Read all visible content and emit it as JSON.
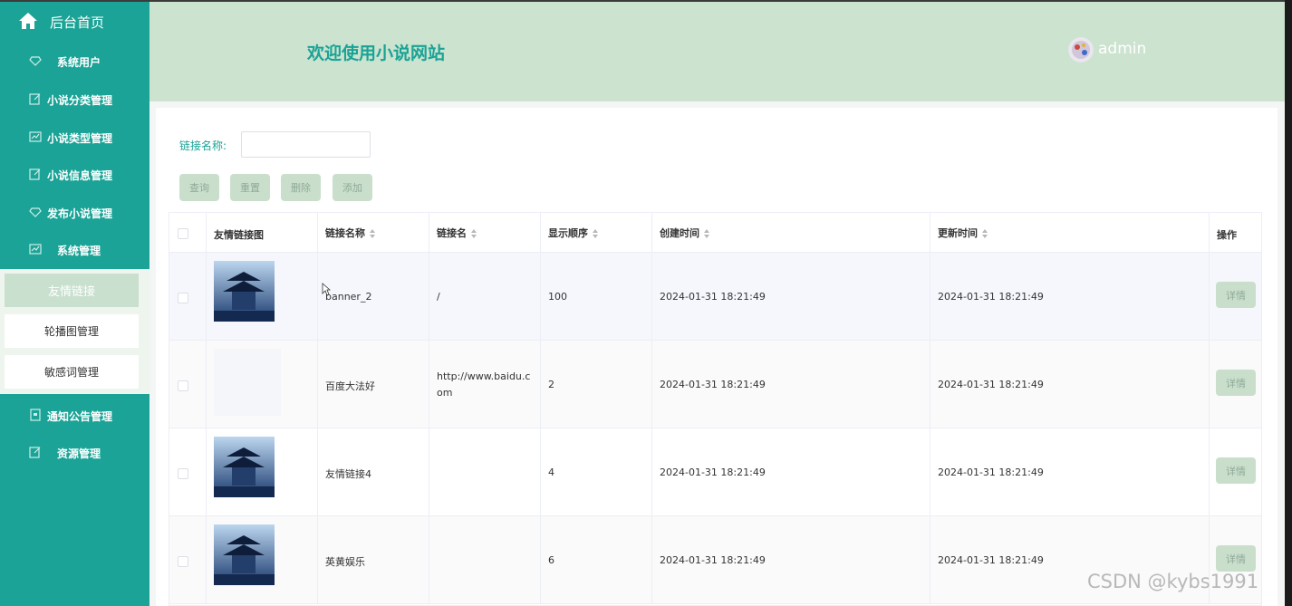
{
  "sidebar": {
    "home_label": "后台首页",
    "items": [
      {
        "label": "系统用户",
        "icon": "diamond-icon"
      },
      {
        "label": "小说分类管理",
        "icon": "edit-icon"
      },
      {
        "label": "小说类型管理",
        "icon": "chart-icon"
      },
      {
        "label": "小说信息管理",
        "icon": "edit-icon"
      },
      {
        "label": "发布小说管理",
        "icon": "diamond-icon"
      },
      {
        "label": "系统管理",
        "icon": "chart-icon"
      }
    ],
    "sub_items": [
      {
        "label": "友情链接",
        "active": true
      },
      {
        "label": "轮播图管理",
        "active": false
      },
      {
        "label": "敏感词管理",
        "active": false
      }
    ],
    "after_items": [
      {
        "label": "通知公告管理",
        "icon": "doc-icon"
      },
      {
        "label": "资源管理",
        "icon": "edit-icon"
      }
    ]
  },
  "header": {
    "title": "欢迎使用小说网站",
    "username": "admin"
  },
  "search": {
    "label": "链接名称:",
    "value": "",
    "placeholder": ""
  },
  "buttons": {
    "query": "查询",
    "reset": "重置",
    "delete": "删除",
    "add": "添加"
  },
  "table": {
    "columns": [
      "友情链接图",
      "链接名称",
      "链接名",
      "显示顺序",
      "创建时间",
      "更新时间",
      "操作"
    ],
    "rows": [
      {
        "has_image": true,
        "name": "banner_2",
        "link": "/",
        "order": "100",
        "created": "2024-01-31 18:21:49",
        "updated": "2024-01-31 18:21:49",
        "action": "详情"
      },
      {
        "has_image": false,
        "name": "百度大法好",
        "link": "http://www.baidu.com",
        "link_line1": "http://www.baidu.c",
        "link_line2": "om",
        "order": "2",
        "created": "2024-01-31 18:21:49",
        "updated": "2024-01-31 18:21:49",
        "action": "详情"
      },
      {
        "has_image": true,
        "name": "友情链接4",
        "link": "",
        "order": "4",
        "created": "2024-01-31 18:21:49",
        "updated": "2024-01-31 18:21:49",
        "action": "详情"
      },
      {
        "has_image": true,
        "name": "英黄娱乐",
        "link": "",
        "order": "6",
        "created": "2024-01-31 18:21:49",
        "updated": "2024-01-31 18:21:49",
        "action": "详情"
      }
    ]
  },
  "watermark": "CSDN @kybs1991",
  "colors": {
    "sidebar": "#1aa396",
    "header": "#cce3d0",
    "button": "#c9dfcc",
    "accent": "#1aa396"
  }
}
